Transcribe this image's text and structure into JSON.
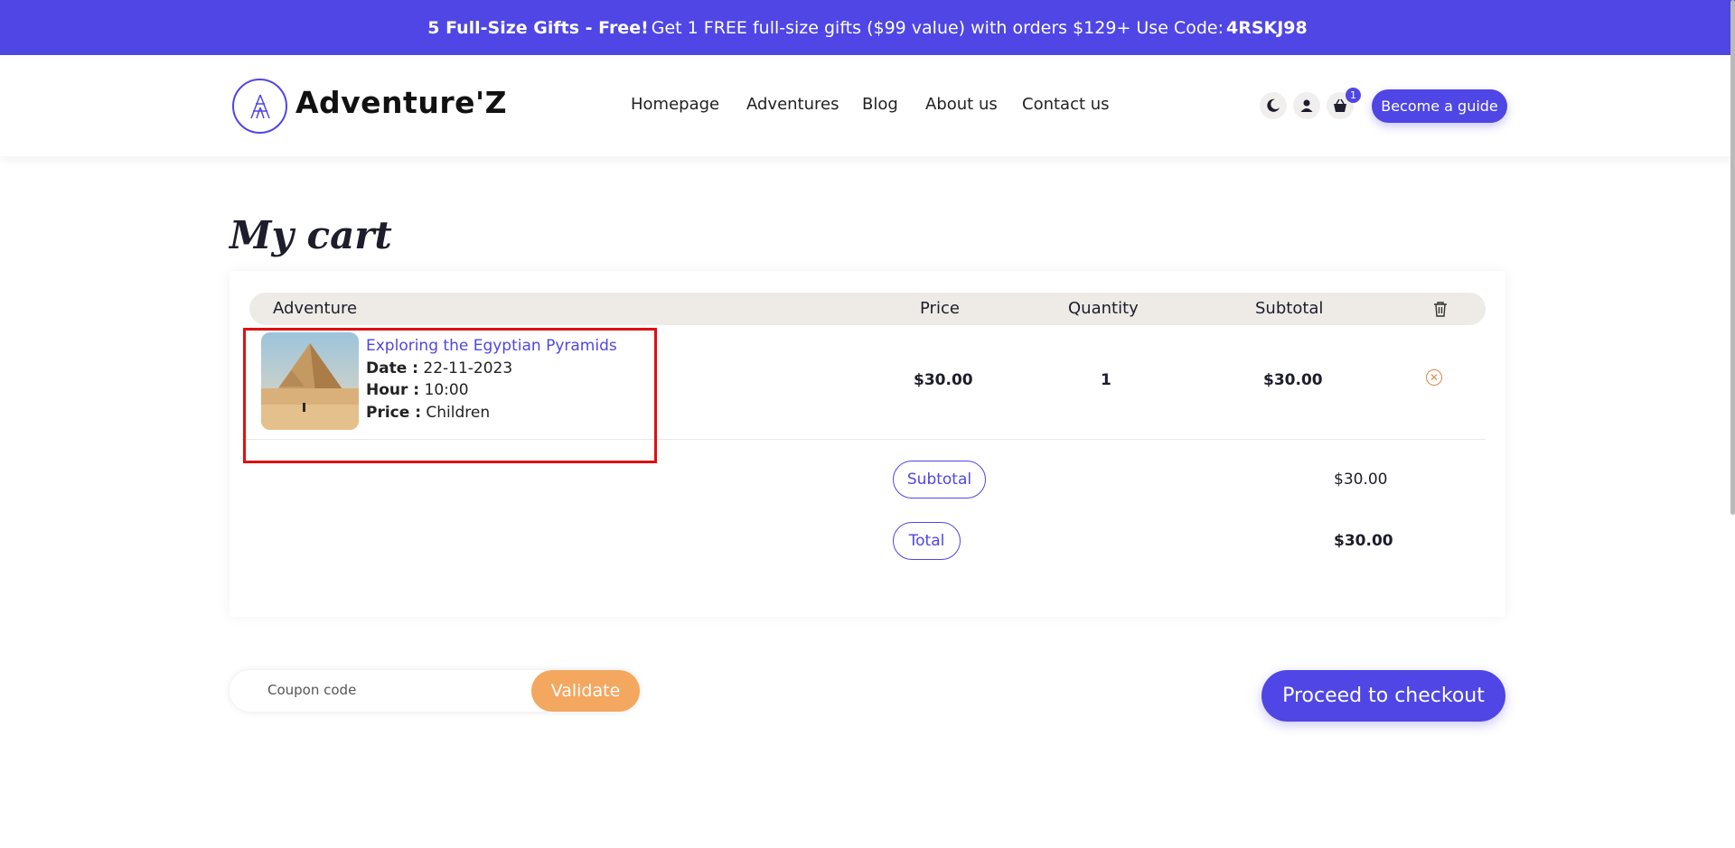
{
  "promo": {
    "headline": "5 Full-Size Gifts - Free!",
    "text": "Get 1 FREE full-size gifts ($99 value) with orders $129+ Use Code:",
    "code": "4RSKJ98"
  },
  "header": {
    "logo_text": "Adventure'Z",
    "nav": [
      "Homepage",
      "Adventures",
      "Blog",
      "About us",
      "Contact us"
    ],
    "cart_count": "1",
    "guide_button": "Become a guide"
  },
  "cart": {
    "title": "My cart",
    "columns": {
      "adventure": "Adventure",
      "price": "Price",
      "quantity": "Quantity",
      "subtotal": "Subtotal"
    },
    "items": [
      {
        "name": "Exploring the Egyptian Pyramids",
        "date_label": "Date :",
        "date": "22-11-2023",
        "hour_label": "Hour :",
        "hour": "10:00",
        "price_label": "Price :",
        "price_type": "Children",
        "price": "$30.00",
        "quantity": "1",
        "subtotal": "$30.00"
      }
    ],
    "summary": {
      "subtotal_label": "Subtotal",
      "subtotal_value": "$30.00",
      "total_label": "Total",
      "total_value": "$30.00"
    }
  },
  "coupon": {
    "placeholder": "Coupon code",
    "validate_label": "Validate"
  },
  "checkout_label": "Proceed to checkout",
  "colors": {
    "primary": "#4f46e5",
    "accent": "#f4a75f",
    "highlight": "#e01010"
  }
}
